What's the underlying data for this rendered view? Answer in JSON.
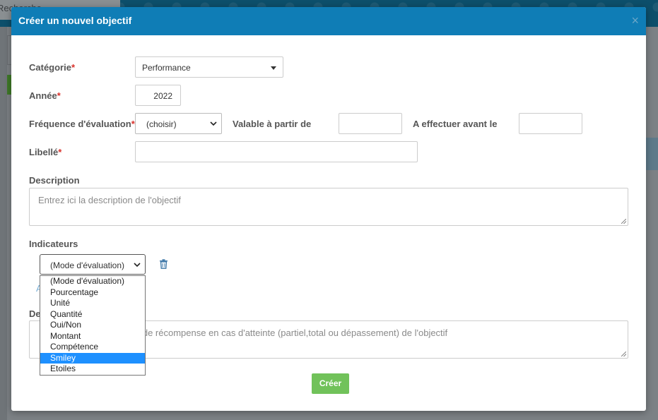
{
  "background": {
    "search_text": "Recherche"
  },
  "modal": {
    "title": "Créer un nouvel objectif",
    "close": "×"
  },
  "form": {
    "categorie": {
      "label": "Catégorie",
      "value": "Performance"
    },
    "annee": {
      "label": "Année",
      "value": "2022"
    },
    "frequence": {
      "label": "Fréquence d'évaluation",
      "value": "(choisir)"
    },
    "valable": {
      "label": "Valable à partir de",
      "value": ""
    },
    "avant": {
      "label": "A effectuer avant le",
      "value": ""
    },
    "libelle": {
      "label": "Libellé",
      "value": ""
    },
    "description": {
      "label": "Description",
      "placeholder": "Entrez ici la description de l'objectif"
    },
    "indicateurs": {
      "label": "Indicateurs",
      "mode_value": "(Mode d'évaluation)",
      "add_link_partial": "A",
      "options": [
        "(Mode d'évaluation)",
        "Pourcentage",
        "Unité",
        "Quantité",
        "Oui/Non",
        "Montant",
        "Compétence",
        "Smiley",
        "Etoiles"
      ],
      "highlighted": "Smiley"
    },
    "recompense": {
      "label_partial": "De",
      "placeholder_partial": "e de récompense en cas d'atteinte (partiel,total ou dépassement) de l'objectif"
    },
    "required_mark": "*"
  },
  "actions": {
    "create": "Créer"
  },
  "colors": {
    "header": "#0f7db6",
    "create_button": "#71c25a",
    "required": "#d9312b",
    "highlight": "#1e90ff"
  }
}
